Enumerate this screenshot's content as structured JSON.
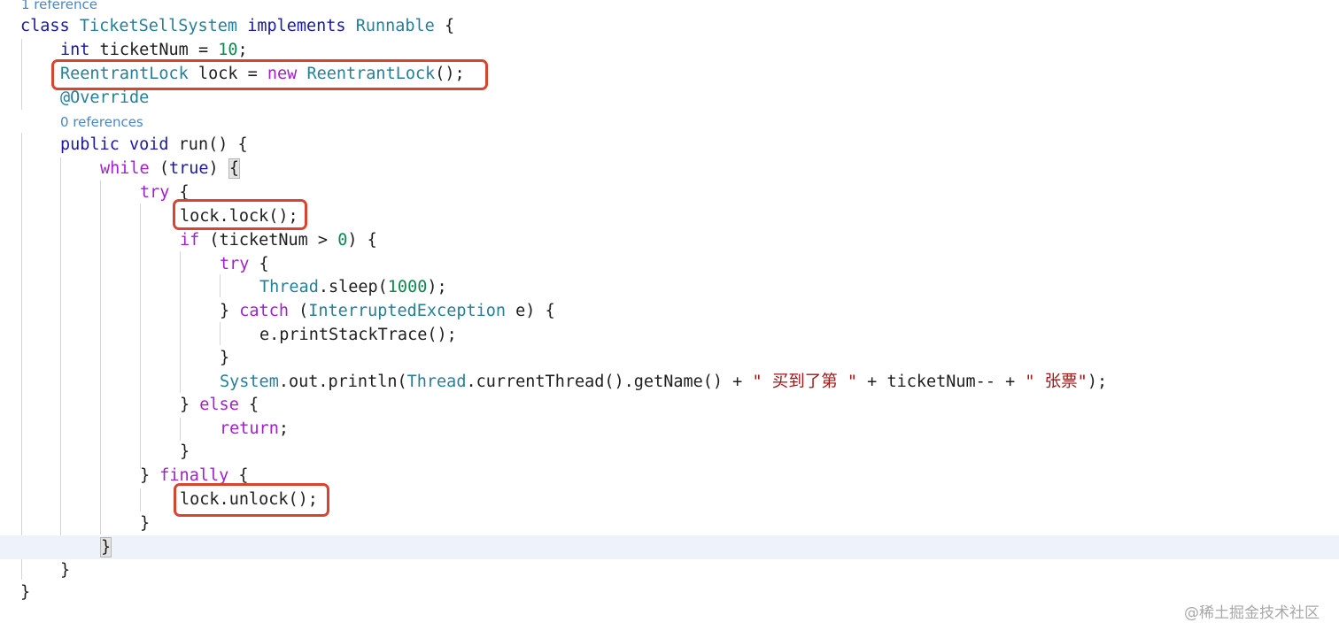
{
  "editor": {
    "references_1": "1 reference",
    "references_0": "0 references",
    "lines": {
      "l1": {
        "c1": "class ",
        "c2": "TicketSellSystem",
        "c3": " ",
        "c4": "implements",
        "c5": " ",
        "c6": "Runnable",
        "c7": " {"
      },
      "l2": {
        "c1": "int",
        "c2": " ticketNum = ",
        "c3": "10",
        "c4": ";"
      },
      "l3": {
        "c1": "ReentrantLock",
        "c2": " lock = ",
        "c3": "new",
        "c4": " ",
        "c5": "ReentrantLock",
        "c6": "();"
      },
      "l4": {
        "c1": "@Override"
      },
      "l5": {
        "c1": "public",
        "c2": " ",
        "c3": "void",
        "c4": " run() {"
      },
      "l6": {
        "c1": "while",
        "c2": " (",
        "c3": "true",
        "c4": ") ",
        "c5": "{"
      },
      "l7": {
        "c1": "try",
        "c2": " {"
      },
      "l8": {
        "c1": "lock.lock();"
      },
      "l9": {
        "c1": "if",
        "c2": " (ticketNum > ",
        "c3": "0",
        "c4": ") {"
      },
      "l10": {
        "c1": "try",
        "c2": " {"
      },
      "l11": {
        "c1": "Thread",
        "c2": ".sleep(",
        "c3": "1000",
        "c4": ");"
      },
      "l12": {
        "c1": "} ",
        "c2": "catch",
        "c3": " (",
        "c4": "InterruptedException",
        "c5": " e) {"
      },
      "l13": {
        "c1": "e.printStackTrace();"
      },
      "l14": {
        "c1": "}"
      },
      "l15": {
        "c1": "System",
        "c2": ".out.println(",
        "c3": "Thread",
        "c4": ".currentThread().getName() + ",
        "c5": "\" 买到了第 \"",
        "c6": " + ticketNum-- + ",
        "c7": "\" 张票\"",
        "c8": ");"
      },
      "l16": {
        "c1": "} ",
        "c2": "else",
        "c3": " {"
      },
      "l17": {
        "c1": "return",
        "c2": ";"
      },
      "l18": {
        "c1": "}"
      },
      "l19": {
        "c1": "} ",
        "c2": "finally",
        "c3": " {"
      },
      "l20": {
        "c1": "lock.unlock();"
      },
      "l21": {
        "c1": "}"
      },
      "l22": {
        "c1": "}"
      },
      "l23": {
        "c1": "}"
      },
      "l24": {
        "c1": "}"
      }
    }
  },
  "watermark": "@稀土掘金技术社区",
  "colors": {
    "keyword": "#a020d0",
    "keyword_blue": "#1a1aa6",
    "type": "#267f99",
    "number": "#0b8a4f",
    "string": "#a31515",
    "highlight_box": "#d8452e",
    "codelens": "#4a86c8"
  }
}
